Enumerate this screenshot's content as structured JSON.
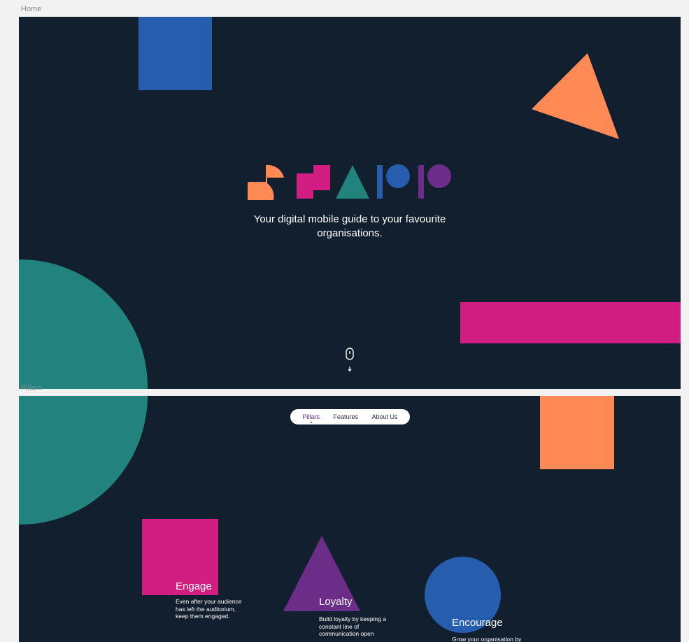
{
  "frames": {
    "home_label": "Home",
    "pillars_label": "Pillars"
  },
  "colors": {
    "background": "#121f2f",
    "orange": "#ff8a55",
    "pink": "#d21e83",
    "teal": "#21837c",
    "blue": "#265ead",
    "purple": "#6b2d88"
  },
  "home": {
    "tagline": "Your digital mobile guide to your favourite organisations."
  },
  "nav": {
    "items": [
      "Pillars",
      "Features",
      "About Us"
    ],
    "active": "Pillars"
  },
  "pillars": [
    {
      "title": "Engage",
      "description": "Even after your audience has left the auditorium, keep them engaged."
    },
    {
      "title": "Loyalty",
      "description": "Build loyalty by keeping a constant line of communication open"
    },
    {
      "title": "Encourage",
      "description": "Grow your organisation by"
    }
  ]
}
